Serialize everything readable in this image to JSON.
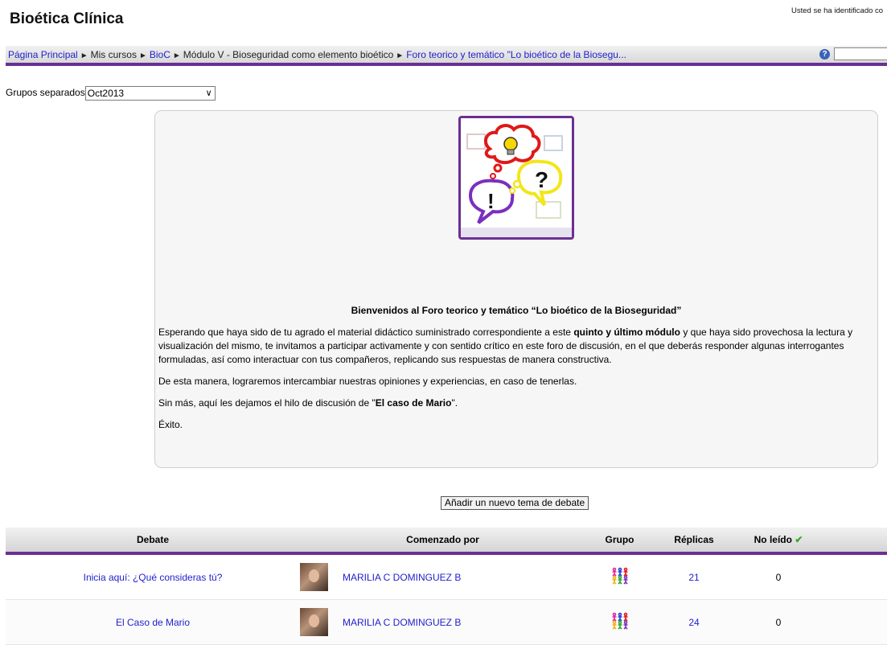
{
  "header": {
    "site_title": "Bioética Clínica",
    "login_info": "Usted se ha identificado co"
  },
  "navbar": {
    "breadcrumb": [
      {
        "label": "Página Principal",
        "link": true
      },
      {
        "label": "Mis cursos",
        "link": false
      },
      {
        "label": "BioC",
        "link": true
      },
      {
        "label": "Módulo V - Bioseguridad como elemento bioético",
        "link": false
      },
      {
        "label": "Foro teorico y temático \"Lo bioético de la Biosegu...",
        "link": true
      }
    ],
    "separator": "►",
    "help_icon": "?",
    "search_value": ""
  },
  "groups": {
    "label": "Grupos separados",
    "selected": "Oct2013"
  },
  "intro": {
    "title": "Bienvenidos al Foro teorico y temático “Lo bioético de la Bioseguridad”",
    "p1_before": "Esperando que haya sido de tu agrado el material didáctico suministrado correspondiente a este ",
    "p1_bold": "quinto y último módulo",
    "p1_after": " y que haya sido provechosa la lectura y visualización del mismo, te invitamos a participar activamente y con sentido crítico en este foro de discusión, en el que deberás responder algunas interrogantes formuladas, así como interactuar con tus compañeros, replicando sus respuestas de manera constructiva.",
    "p2": "De esta manera, lograremos intercambiar nuestras opiniones y experiencias, en caso de tenerlas.",
    "p3_before": "Sin más, aquí les dejamos el hilo de discusión de \"",
    "p3_bold": "El caso de Mario",
    "p3_after": "\".",
    "p4": "Éxito."
  },
  "add_topic_button": "Añadir un nuevo tema de debate",
  "table": {
    "headers": {
      "topic": "Debate",
      "author": "Comenzado por",
      "group": "Grupo",
      "replies": "Réplicas",
      "unread": "No leído"
    },
    "rows": [
      {
        "topic": "Inicia aquí: ¿Qué consideras tú?",
        "author": "MARILIA C DOMINGUEZ B",
        "replies": "21",
        "unread": "0"
      },
      {
        "topic": "El Caso de Mario",
        "author": "MARILIA C DOMINGUEZ B",
        "replies": "24",
        "unread": "0"
      }
    ]
  },
  "colors": {
    "accent_purple": "#6b2f93",
    "link_blue": "#1f1fcc",
    "check_green": "#3aa82c"
  }
}
